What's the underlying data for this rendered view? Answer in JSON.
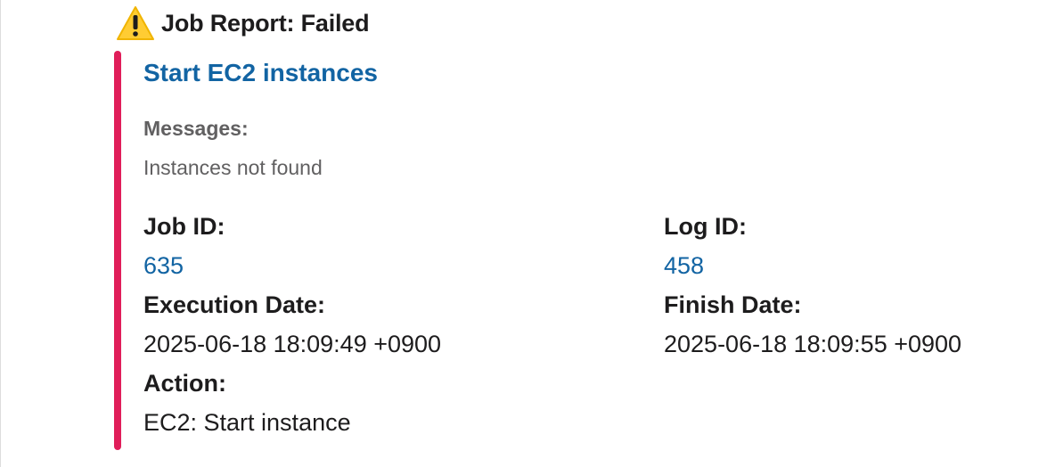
{
  "header": {
    "icon": "warning-icon",
    "title": "Job Report: Failed"
  },
  "attachment": {
    "bar_color": "#e01e5a",
    "title": "Start EC2 instances",
    "messages_label": "Messages:",
    "messages_text": "Instances not found",
    "fields": {
      "job_id_label": "Job ID:",
      "job_id_value": "635",
      "log_id_label": "Log ID:",
      "log_id_value": "458",
      "execution_date_label": "Execution Date:",
      "execution_date_value": "2025-06-18 18:09:49 +0900",
      "finish_date_label": "Finish Date:",
      "finish_date_value": "2025-06-18 18:09:55 +0900",
      "action_label": "Action:",
      "action_value": "EC2: Start instance"
    }
  },
  "colors": {
    "link": "#1264a3",
    "text": "#1d1c1d",
    "muted": "#616061"
  }
}
